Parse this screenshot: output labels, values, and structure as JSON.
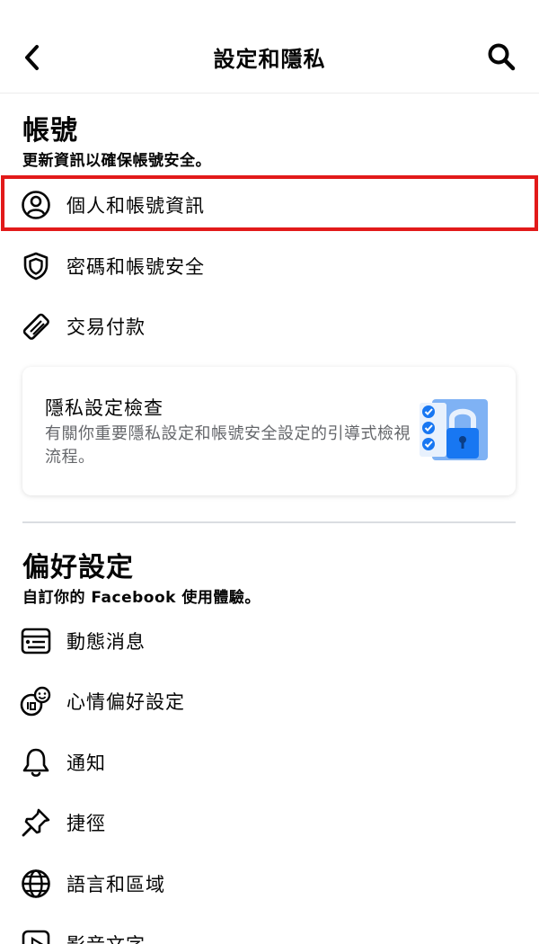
{
  "header": {
    "title": "設定和隱私"
  },
  "account": {
    "title": "帳號",
    "subtitle": "更新資訊以確保帳號安全。",
    "items": [
      {
        "label": "個人和帳號資訊",
        "icon": "user-circle-icon"
      },
      {
        "label": "密碼和帳號安全",
        "icon": "shield-icon"
      },
      {
        "label": "交易付款",
        "icon": "tag-icon"
      }
    ]
  },
  "privacy_card": {
    "title": "隱私設定檢查",
    "description": "有關你重要隱私設定和帳號安全設定的引導式檢視流程。"
  },
  "preferences": {
    "title": "偏好設定",
    "subtitle": "自訂你的 Facebook 使用體驗。",
    "items": [
      {
        "label": "動態消息",
        "icon": "news-feed-icon"
      },
      {
        "label": "心情偏好設定",
        "icon": "reactions-icon"
      },
      {
        "label": "通知",
        "icon": "bell-icon"
      },
      {
        "label": "捷徑",
        "icon": "pin-icon"
      },
      {
        "label": "語言和區域",
        "icon": "globe-icon"
      },
      {
        "label": "影音文字",
        "icon": "media-icon"
      }
    ]
  },
  "colors": {
    "highlight": "#e21a1a",
    "accent_blue": "#1877f2"
  }
}
